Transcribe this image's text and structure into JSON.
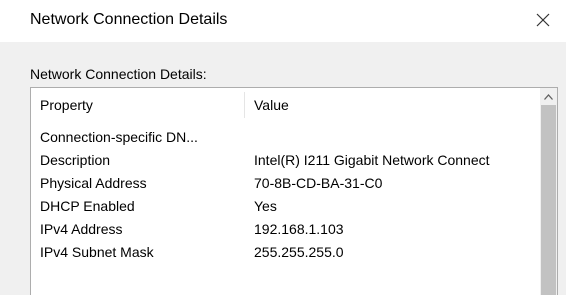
{
  "window": {
    "title": "Network Connection Details",
    "close_icon": "close-icon"
  },
  "group": {
    "label": "Network Connection Details:"
  },
  "table": {
    "columns": [
      "Property",
      "Value"
    ],
    "rows": [
      {
        "property": "Connection-specific DN...",
        "value": ""
      },
      {
        "property": "Description",
        "value": "Intel(R) I211 Gigabit Network Connect"
      },
      {
        "property": "Physical Address",
        "value": "70-8B-CD-BA-31-C0"
      },
      {
        "property": "DHCP Enabled",
        "value": "Yes"
      },
      {
        "property": "IPv4 Address",
        "value": "192.168.1.103"
      },
      {
        "property": "IPv4 Subnet Mask",
        "value": "255.255.255.0"
      }
    ]
  },
  "scrollbar": {
    "up_icon": "chevron-up-icon"
  }
}
